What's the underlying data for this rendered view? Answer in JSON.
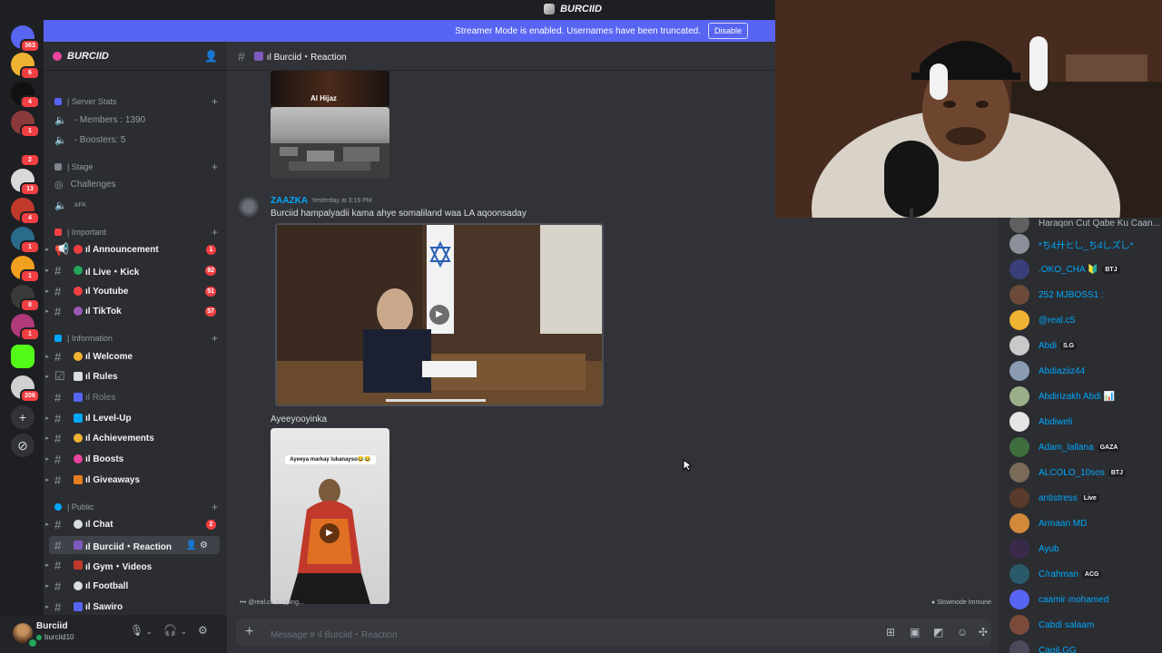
{
  "window_title": "BURCIID",
  "streamer_bar": {
    "text": "Streamer Mode is enabled. Usernames have been truncated.",
    "disable": "Disable"
  },
  "server_rail": [
    {
      "badge": "363"
    },
    {
      "badge": "6"
    },
    {
      "badge": "4"
    },
    {
      "badge": "1"
    },
    {
      "badge": "2"
    },
    {
      "badge": "13"
    },
    {
      "badge": "4"
    },
    {
      "badge": "1"
    },
    {
      "badge": "1"
    },
    {
      "badge": "8"
    },
    {
      "badge": "1"
    },
    {
      "badge": ""
    },
    {
      "badge": "206"
    }
  ],
  "guild": {
    "name": "BURCIID"
  },
  "categories": {
    "server_stats": "| Server Stats",
    "stage": "| Stage",
    "important": "| Important",
    "information": "| Information",
    "public": "| Public"
  },
  "stats": {
    "members": "- Members : 1390",
    "boosters": "- Boosters: 5"
  },
  "stage_items": {
    "challenges": "Challenges",
    "afk": "AFK"
  },
  "channels": {
    "announcement": {
      "label": "ıl Announcement",
      "count": "1"
    },
    "live_kick": {
      "label": "ıl Live・Kick",
      "count": "92"
    },
    "youtube": {
      "label": "ıl Youtube",
      "count": "51"
    },
    "tiktok": {
      "label": "ıl TikTok",
      "count": "57"
    },
    "welcome": {
      "label": "ıl Welcome"
    },
    "rules": {
      "label": "ıl Rules"
    },
    "roles": {
      "label": "ıl Roles"
    },
    "levelup": {
      "label": "ıl Level-Up"
    },
    "achievements": {
      "label": "ıl Achievements"
    },
    "boosts": {
      "label": "ıl Boosts"
    },
    "giveaways": {
      "label": "ıl Giveaways"
    },
    "chat": {
      "label": "ıl Chat",
      "count": "2"
    },
    "reaction": {
      "label": "ıl Burciid・Reaction"
    },
    "gym": {
      "label": "ıl Gym・Videos"
    },
    "football": {
      "label": "ıl Football"
    },
    "sawiro": {
      "label": "ıl Sawiro"
    }
  },
  "user_panel": {
    "name": "Burciid",
    "status": "burciid10"
  },
  "chat_header": {
    "channel": "ıl Burciid・Reaction"
  },
  "messages": {
    "author": "ZAAZKA",
    "timestamp": "Yesterday at 3:19 PM",
    "text1": "Burciid hampalyadii kama ahye somaliland waa LA aqoonsaday",
    "text2": "Ayeeyooyinka",
    "thumb_caption_top": "Al Hijaz",
    "thumb_caption_video": "Ayeeya markay lukanayso😂😂"
  },
  "typing": "@real.c5 is typing...",
  "slowmode": "Slowmode Immune",
  "composer": {
    "placeholder": "Message # ıl Burciid・Reaction"
  },
  "members": [
    {
      "name": "Haraqon Cut Qabe Ku Caan...",
      "tag": "",
      "color": "#b5bac1",
      "av": "#606060"
    },
    {
      "name": "*ち4廾ヒ乚_ち4乚ズ乚*",
      "tag": "",
      "color": "#00a8fc",
      "av": "#8a8f99"
    },
    {
      "name": ".OKO_CHA 🔰",
      "tag": "BTJ",
      "color": "#00a8fc",
      "av": "#3a3f7a"
    },
    {
      "name": "252 MJBOSS1 :",
      "tag": "",
      "color": "#00a8fc",
      "av": "#6b4a3a"
    },
    {
      "name": "@real.c5",
      "tag": "",
      "color": "#00a8fc",
      "av": "#f0b232"
    },
    {
      "name": "Abdi",
      "tag": "S.G",
      "color": "#00a8fc",
      "av": "#c9c9c9"
    },
    {
      "name": "Abdiaziiz44",
      "tag": "",
      "color": "#00a8fc",
      "av": "#8b9bb4"
    },
    {
      "name": "Abdirizakh Abdi 📊",
      "tag": "",
      "color": "#00a8fc",
      "av": "#9bb08a"
    },
    {
      "name": "Abdiweli",
      "tag": "",
      "color": "#00a8fc",
      "av": "#e5e5e5"
    },
    {
      "name": "Adam_lallana",
      "tag": "GAZA",
      "color": "#00a8fc",
      "av": "#3e6e3e"
    },
    {
      "name": "ALCOLO_10sos",
      "tag": "BTJ",
      "color": "#00a8fc",
      "av": "#7a6a5a"
    },
    {
      "name": "antistress",
      "tag": "Live",
      "color": "#00a8fc",
      "av": "#5a3a2a"
    },
    {
      "name": "Armaan MD",
      "tag": "",
      "color": "#00a8fc",
      "av": "#d08a3a"
    },
    {
      "name": "Ayub",
      "tag": "",
      "color": "#00a8fc",
      "av": "#3a2a4a"
    },
    {
      "name": "C/rahman",
      "tag": "ACG",
      "color": "#00a8fc",
      "av": "#2a5a6a"
    },
    {
      "name": "caamir mohamed",
      "tag": "",
      "color": "#00a8fc",
      "av": "#5865f2"
    },
    {
      "name": "Cabdi salaam",
      "tag": "",
      "color": "#00a8fc",
      "av": "#7a4a3a"
    },
    {
      "name": "CaqiLGG",
      "tag": "",
      "color": "#00a8fc",
      "av": "#4a4a5a"
    }
  ],
  "colors": {
    "accent": "#5865f2",
    "badge": "#f23f43",
    "online": "#23a55a",
    "link": "#00a8fc"
  }
}
